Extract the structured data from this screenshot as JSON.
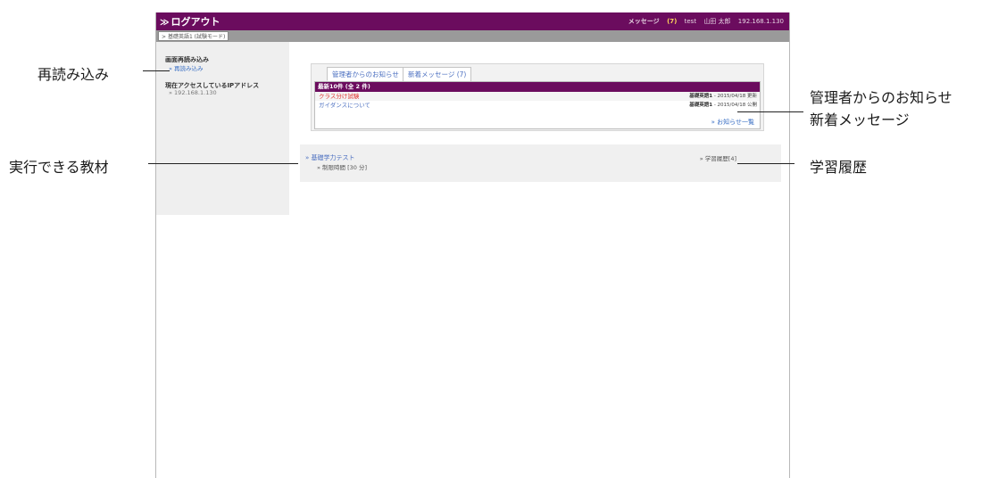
{
  "topbar": {
    "logout_label": "ログアウト",
    "message_label": "メッセージ",
    "message_count": "(7)",
    "user_id": "test",
    "user_name": "山田 太郎",
    "ip": "192.168.1.130"
  },
  "course_tab": "基礎英語1 (試験モード)",
  "sidebar": {
    "reload_heading": "画面再読み込み",
    "reload_link": "再読み込み",
    "ip_heading": "現在アクセスしているIPアドレス",
    "ip_value": "192.168.1.130"
  },
  "notice": {
    "tabs": [
      "管理者からのお知らせ",
      "新着メッセージ (7)"
    ],
    "header": "最新10件 (全 2 件)",
    "rows": [
      {
        "title": "クラス分け試験",
        "course": "基礎英語1",
        "date": "- 2015/04/18 更新",
        "color": "#e0302b"
      },
      {
        "title": "ガイダンスについて",
        "course": "基礎英語1",
        "date": "- 2015/04/18 公開",
        "color": "#4b6fc0"
      }
    ],
    "all_link": "お知らせ一覧"
  },
  "material": {
    "title_link": "基礎学力テスト",
    "time_limit": "制限時間 [30 分]",
    "history_link": "学習履歴[4]"
  },
  "callouts": {
    "reload": "再読み込み",
    "materials": "実行できる教材",
    "admin_notice": "管理者からのお知らせ",
    "new_messages": "新着メッセージ",
    "history": "学習履歴"
  },
  "colors": {
    "brand": "#6b0c5e",
    "link": "#4b6fc0",
    "alert": "#e0302b",
    "count": "#ffd75a"
  }
}
